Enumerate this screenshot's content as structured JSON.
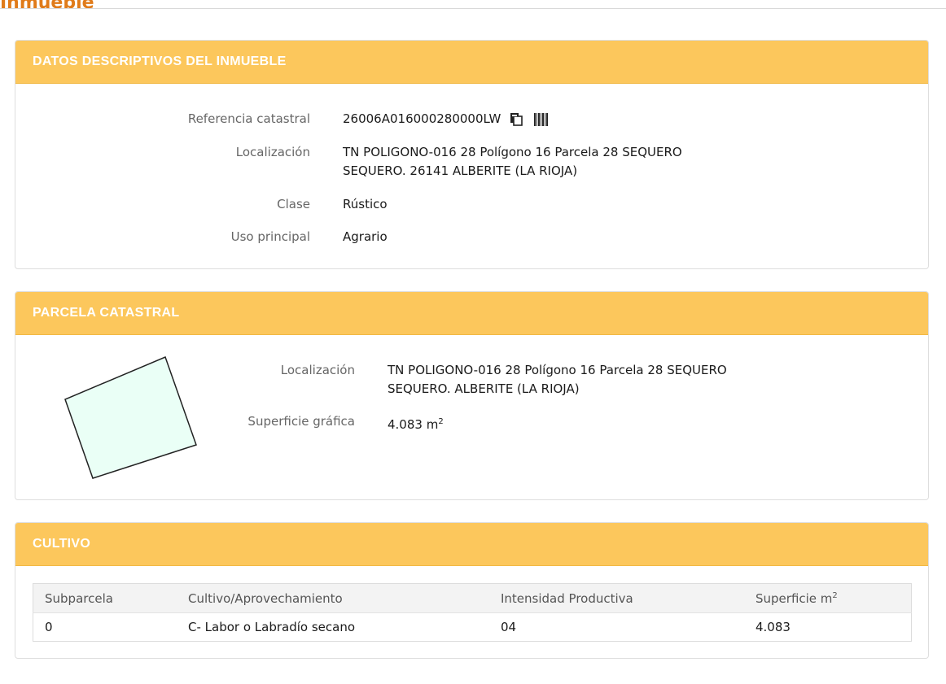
{
  "page": {
    "heading": "Inmueble"
  },
  "datos": {
    "title": "DATOS DESCRIPTIVOS DEL INMUEBLE",
    "referencia_label": "Referencia catastral",
    "referencia_value": "26006A016000280000LW",
    "localizacion_label": "Localización",
    "localizacion_line1": "TN POLIGONO-016 28 Polígono 16 Parcela 28 SEQUERO",
    "localizacion_line2": "SEQUERO. 26141 ALBERITE (LA RIOJA)",
    "clase_label": "Clase",
    "clase_value": "Rústico",
    "uso_label": "Uso principal",
    "uso_value": "Agrario",
    "icons": [
      "copy-icon",
      "barcode-icon"
    ]
  },
  "parcela": {
    "title": "PARCELA CATASTRAL",
    "localizacion_label": "Localización",
    "localizacion_line1": "TN POLIGONO-016 28 Polígono 16 Parcela 28 SEQUERO",
    "localizacion_line2": "SEQUERO. ALBERITE (LA RIOJA)",
    "superficie_label": "Superficie gráfica",
    "superficie_value": "4.083 m",
    "superficie_unit_sup": "2",
    "shape_fill": "#eafff6",
    "shape_stroke": "#222222"
  },
  "cultivo": {
    "title": "CULTIVO",
    "headers": [
      "Subparcela",
      "Cultivo/Aprovechamiento",
      "Intensidad Productiva",
      "Superficie m"
    ],
    "header_sup": "2",
    "rows": [
      [
        "0",
        "C- Labor o Labradío secano",
        "04",
        "4.083"
      ]
    ]
  },
  "colors": {
    "accent": "#fcc75c",
    "heading_orange": "#e07b1a"
  }
}
